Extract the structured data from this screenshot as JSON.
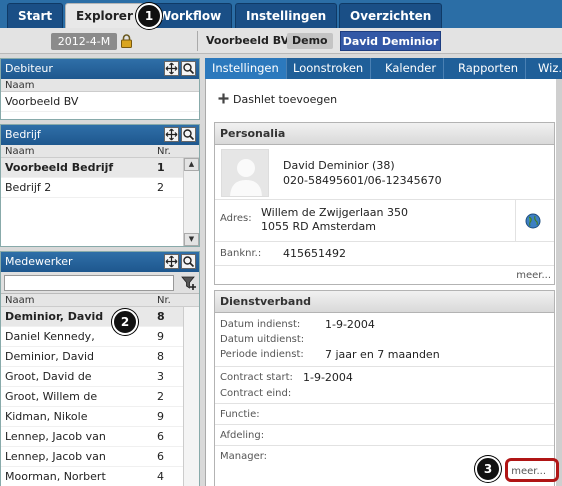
{
  "topnav": {
    "tabs": [
      {
        "label": "Start"
      },
      {
        "label": "Explorer"
      },
      {
        "label": "Workflow"
      },
      {
        "label": "Instellingen"
      },
      {
        "label": "Overzichten"
      }
    ]
  },
  "statusbar": {
    "period": "2012-4-M",
    "company": "Voorbeeld BV",
    "demo_badge": "Demo",
    "user": "David Deminior"
  },
  "debiteur": {
    "title": "Debiteur",
    "col_name": "Naam",
    "rows": [
      "Voorbeeld BV"
    ]
  },
  "bedrijf": {
    "title": "Bedrijf",
    "col_name": "Naam",
    "col_nr": "Nr.",
    "rows": [
      {
        "name": "Voorbeeld Bedrijf",
        "nr": "1"
      },
      {
        "name": "Bedrijf 2",
        "nr": "2"
      }
    ]
  },
  "medewerker": {
    "title": "Medewerker",
    "search_value": "",
    "col_name": "Naam",
    "col_nr": "Nr.",
    "rows": [
      {
        "name": "Deminior, David",
        "nr": "8"
      },
      {
        "name": "Daniel Kennedy,",
        "nr": "9"
      },
      {
        "name": "Deminior, David",
        "nr": "8"
      },
      {
        "name": "Groot, David de",
        "nr": "3"
      },
      {
        "name": "Groot, Willem de",
        "nr": "2"
      },
      {
        "name": "Kidman, Nikole",
        "nr": "9"
      },
      {
        "name": "Lennep, Jacob van",
        "nr": "6"
      },
      {
        "name": "Lennep, Jacob van",
        "nr": "6"
      },
      {
        "name": "Moorman, Norbert",
        "nr": "4"
      }
    ]
  },
  "righttabs": [
    "Instellingen",
    "Loonstroken",
    "Kalender",
    "Rapporten",
    "Wiz..."
  ],
  "dashlet_add": "Dashlet toevoegen",
  "personalia": {
    "title": "Personalia",
    "name_line": "David Deminior (38)",
    "phone_line": "020-58495601/06-12345670",
    "adres_label": "Adres:",
    "adres_line1": "Willem de Zwijgerlaan 350",
    "adres_line2": "1055 RD Amsterdam",
    "bank_label": "Banknr.:",
    "bank_value": "415651492",
    "more": "meer..."
  },
  "dienstverband": {
    "title": "Dienstverband",
    "datum_indienst_label": "Datum indienst:",
    "datum_indienst_value": "1-9-2004",
    "datum_uitdienst_label": "Datum uitdienst:",
    "periode_indienst_label": "Periode indienst:",
    "periode_indienst_value": "7 jaar en 7 maanden",
    "contract_start_label": "Contract start:",
    "contract_start_value": "1-9-2004",
    "contract_eind_label": "Contract eind:",
    "functie_label": "Functie:",
    "afdeling_label": "Afdeling:",
    "manager_label": "Manager:",
    "more": "meer..."
  },
  "callouts": [
    "1",
    "2",
    "3"
  ],
  "colors": {
    "nav_blue": "#2b6ea6",
    "user_button": "#3358a6",
    "highlight_red": "#b01515"
  }
}
